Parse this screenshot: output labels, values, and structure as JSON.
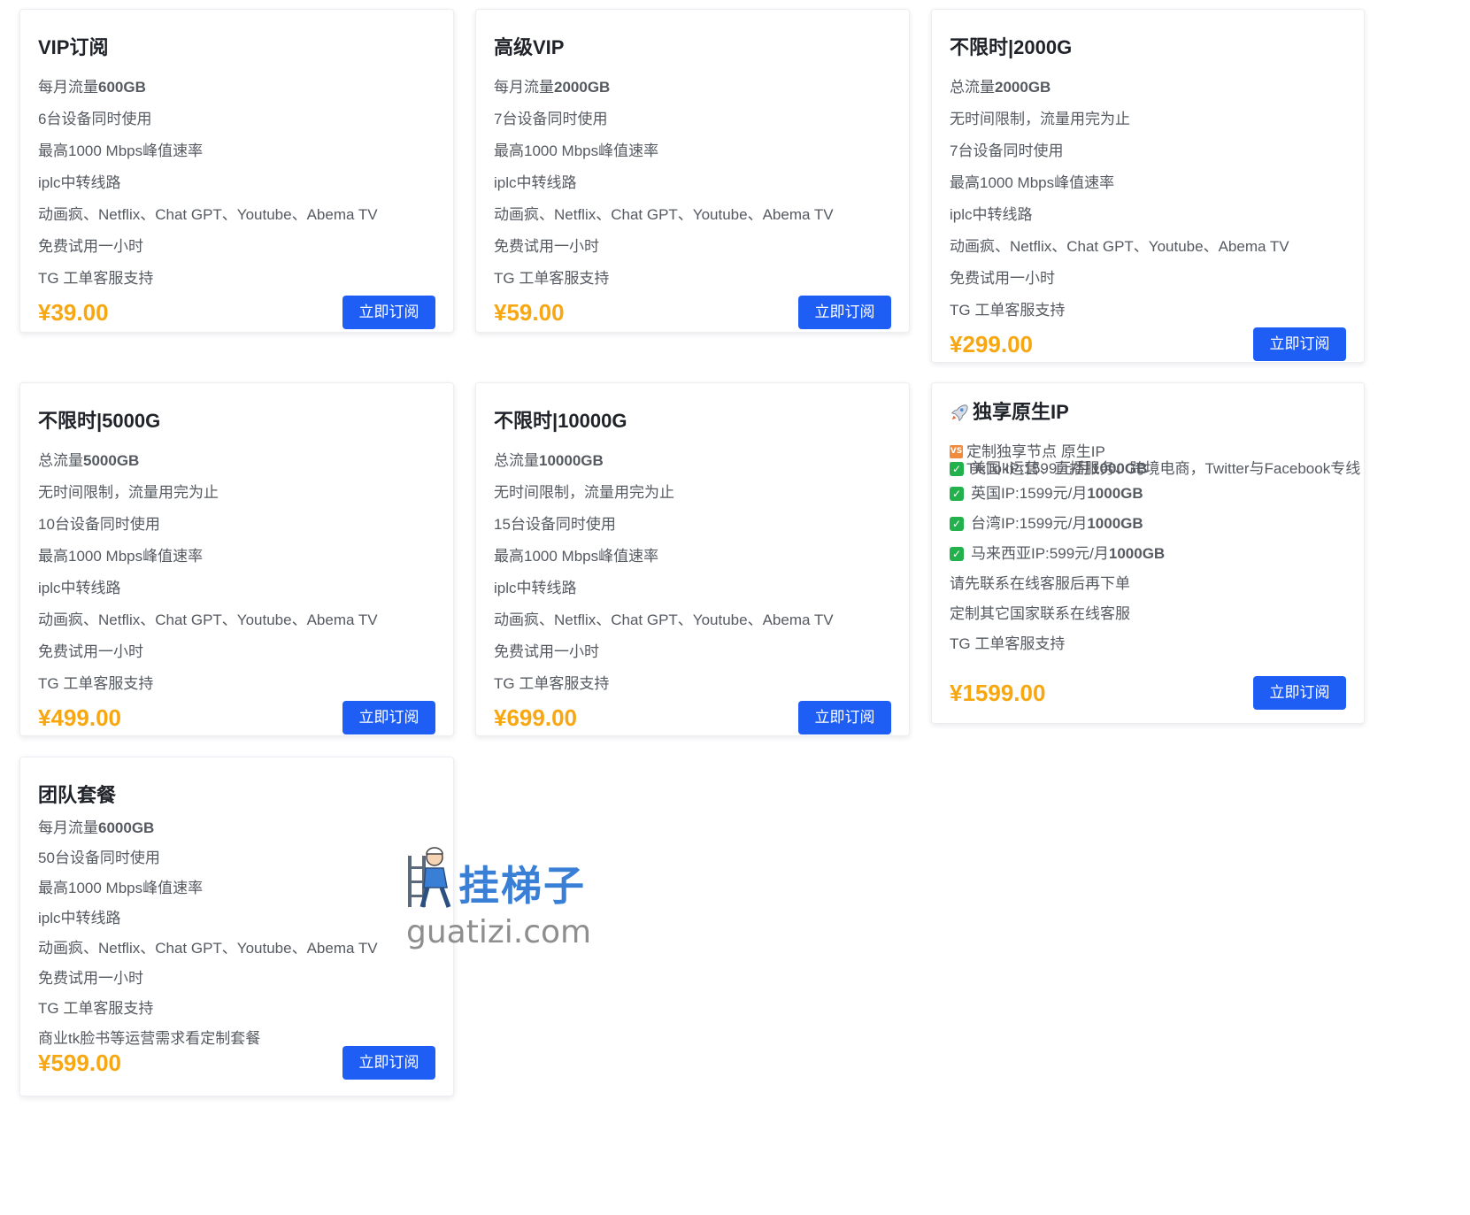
{
  "plans": [
    {
      "title": "VIP订阅",
      "features": [
        {
          "pre": "每月流量",
          "bold": "600GB"
        },
        {
          "pre": "6台设备同时使用",
          "bold": ""
        },
        {
          "pre": "最高1000 Mbps峰值速率",
          "bold": ""
        },
        {
          "pre": "iplc中转线路",
          "bold": ""
        },
        {
          "pre": "动画疯、Netflix、Chat GPT、Youtube、Abema TV",
          "bold": ""
        },
        {
          "pre": "免费试用一小时",
          "bold": ""
        },
        {
          "pre": "TG 工单客服支持",
          "bold": ""
        }
      ],
      "price": "¥39.00",
      "button": "立即订阅"
    },
    {
      "title": "高级VIP",
      "features": [
        {
          "pre": "每月流量",
          "bold": "2000GB"
        },
        {
          "pre": "7台设备同时使用",
          "bold": ""
        },
        {
          "pre": "最高1000 Mbps峰值速率",
          "bold": ""
        },
        {
          "pre": "iplc中转线路",
          "bold": ""
        },
        {
          "pre": "动画疯、Netflix、Chat GPT、Youtube、Abema TV",
          "bold": ""
        },
        {
          "pre": "免费试用一小时",
          "bold": ""
        },
        {
          "pre": "TG 工单客服支持",
          "bold": ""
        }
      ],
      "price": "¥59.00",
      "button": "立即订阅"
    },
    {
      "title": "不限时|2000G",
      "features": [
        {
          "pre": "总流量",
          "bold": "2000GB"
        },
        {
          "pre": "无时间限制，流量用完为止",
          "bold": ""
        },
        {
          "pre": "7台设备同时使用",
          "bold": ""
        },
        {
          "pre": "最高1000 Mbps峰值速率",
          "bold": ""
        },
        {
          "pre": "iplc中转线路",
          "bold": ""
        },
        {
          "pre": "动画疯、Netflix、Chat GPT、Youtube、Abema TV",
          "bold": ""
        },
        {
          "pre": "免费试用一小时",
          "bold": ""
        },
        {
          "pre": "TG 工单客服支持",
          "bold": ""
        }
      ],
      "price": "¥299.00",
      "button": "立即订阅"
    },
    {
      "title": "不限时|5000G",
      "features": [
        {
          "pre": "总流量",
          "bold": "5000GB"
        },
        {
          "pre": "无时间限制，流量用完为止",
          "bold": ""
        },
        {
          "pre": "10台设备同时使用",
          "bold": ""
        },
        {
          "pre": "最高1000 Mbps峰值速率",
          "bold": ""
        },
        {
          "pre": "iplc中转线路",
          "bold": ""
        },
        {
          "pre": "动画疯、Netflix、Chat GPT、Youtube、Abema TV",
          "bold": ""
        },
        {
          "pre": "免费试用一小时",
          "bold": ""
        },
        {
          "pre": "TG 工单客服支持",
          "bold": ""
        }
      ],
      "price": "¥499.00",
      "button": "立即订阅"
    },
    {
      "title": "不限时|10000G",
      "features": [
        {
          "pre": "总流量",
          "bold": "10000GB"
        },
        {
          "pre": "无时间限制，流量用完为止",
          "bold": ""
        },
        {
          "pre": "15台设备同时使用",
          "bold": ""
        },
        {
          "pre": "最高1000 Mbps峰值速率",
          "bold": ""
        },
        {
          "pre": "iplc中转线路",
          "bold": ""
        },
        {
          "pre": "动画疯、Netflix、Chat GPT、Youtube、Abema TV",
          "bold": ""
        },
        {
          "pre": "免费试用一小时",
          "bold": ""
        },
        {
          "pre": "TG 工单客服支持",
          "bold": ""
        }
      ],
      "price": "¥699.00",
      "button": "立即订阅"
    },
    {
      "title": "团队套餐",
      "features": [
        {
          "pre": "每月流量",
          "bold": "6000GB"
        },
        {
          "pre": "50台设备同时使用",
          "bold": ""
        },
        {
          "pre": "最高1000 Mbps峰值速率",
          "bold": ""
        },
        {
          "pre": "iplc中转线路",
          "bold": ""
        },
        {
          "pre": "动画疯、Netflix、Chat GPT、Youtube、Abema TV",
          "bold": ""
        },
        {
          "pre": "免费试用一小时",
          "bold": ""
        },
        {
          "pre": "TG 工单客服支持",
          "bold": ""
        },
        {
          "pre": "商业tk脸书等运营需求看定制套餐",
          "bold": ""
        }
      ],
      "price": "¥599.00",
      "button": "立即订阅"
    }
  ],
  "native_ip": {
    "title": "独享原生IP",
    "title_icon": "rocket-icon",
    "vs_lines": [
      "定制独享节点 原生IP",
      "TikTok运营、直播服务、跨境电商，Twitter与Facebook专线"
    ],
    "vs_badge": "VS",
    "ip_rows": [
      {
        "pre": "美国 IP:1599元/月",
        "bold": "1000GB"
      },
      {
        "pre": "英国IP:1599元/月",
        "bold": "1000GB"
      },
      {
        "pre": "台湾IP:1599元/月",
        "bold": "1000GB"
      },
      {
        "pre": "马来西亚IP:599元/月",
        "bold": "1000GB"
      }
    ],
    "check_icon": "check-box-icon",
    "notes": [
      "请先联系在线客服后再下单",
      "定制其它国家联系在线客服",
      "TG 工单客服支持"
    ],
    "price": "¥1599.00",
    "button": "立即订阅"
  },
  "watermark": {
    "cn": "挂梯子",
    "url": "guatizi.com"
  },
  "colors": {
    "accent": "#1f5ef5",
    "price": "#f7a712",
    "check": "#22b14c",
    "vs_badge": "#f08a3c"
  }
}
